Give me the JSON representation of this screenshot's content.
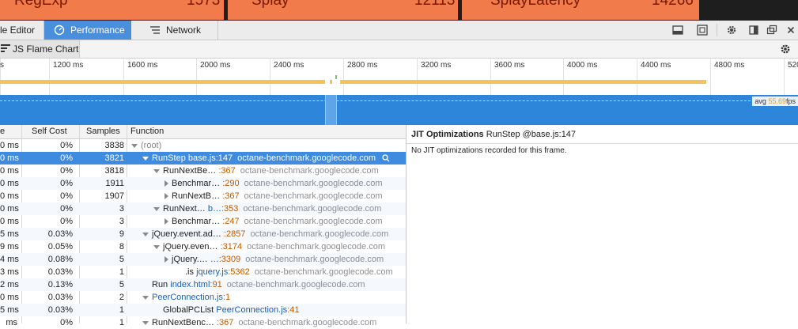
{
  "benchmarks": [
    {
      "name": "RegExp",
      "score": "1573"
    },
    {
      "name": "Splay",
      "score": "12113"
    },
    {
      "name": "SplayLatency",
      "score": "14266"
    }
  ],
  "tabs": {
    "first_partial": "le Editor",
    "performance": "Performance",
    "network": "Network"
  },
  "subtoolbar": {
    "view_label": "JS Flame Chart"
  },
  "timeline": {
    "ticks": [
      "s",
      "1200 ms",
      "1600 ms",
      "2000 ms",
      "2400 ms",
      "2800 ms",
      "3200 ms",
      "3600 ms",
      "4000 ms",
      "4400 ms",
      "4800 ms",
      "520"
    ],
    "fps_label": "avg",
    "fps_value": "55.69",
    "fps_unit": "fps"
  },
  "table": {
    "headers": {
      "total": "e",
      "self": "Self Cost",
      "samples": "Samples",
      "function": "Function"
    },
    "rows": [
      {
        "total": "0 ms",
        "self": "0%",
        "samples": "3838",
        "depth": 0,
        "twisty": "down",
        "name": "(root)",
        "file": "",
        "loc": "",
        "domain": "",
        "root": true
      },
      {
        "total": "0 ms",
        "self": "0%",
        "samples": "3821",
        "depth": 1,
        "twisty": "down",
        "name": "RunStep",
        "file": "base.js",
        "loc": ":147",
        "domain": "octane-benchmark.googlecode.com",
        "selected": true
      },
      {
        "total": "0 ms",
        "self": "0%",
        "samples": "3818",
        "depth": 2,
        "twisty": "down",
        "name": "RunNextBe…",
        "file": "",
        "loc": ":367",
        "domain": "octane-benchmark.googlecode.com"
      },
      {
        "total": "0 ms",
        "self": "0%",
        "samples": "1911",
        "depth": 3,
        "twisty": "right",
        "name": "Benchmar…",
        "file": "",
        "loc": ":290",
        "domain": "octane-benchmark.googlecode.com"
      },
      {
        "total": "0 ms",
        "self": "0%",
        "samples": "1907",
        "depth": 3,
        "twisty": "right",
        "name": "RunNextB…",
        "file": "",
        "loc": ":367",
        "domain": "octane-benchmark.googlecode.com"
      },
      {
        "total": "0 ms",
        "self": "0%",
        "samples": "3",
        "depth": 2,
        "twisty": "down",
        "name": "RunNext…",
        "file": "b…",
        "loc": ":353",
        "domain": "octane-benchmark.googlecode.com"
      },
      {
        "total": "0 ms",
        "self": "0%",
        "samples": "3",
        "depth": 3,
        "twisty": "right",
        "name": "Benchmar…",
        "file": "",
        "loc": ":247",
        "domain": "octane-benchmark.googlecode.com"
      },
      {
        "total": "5 ms",
        "self": "0.03%",
        "samples": "9",
        "depth": 1,
        "twisty": "down",
        "name": "jQuery.event.ad…",
        "file": "",
        "loc": ":2857",
        "domain": "octane-benchmark.googlecode.com"
      },
      {
        "total": "9 ms",
        "self": "0.05%",
        "samples": "8",
        "depth": 2,
        "twisty": "down",
        "name": "jQuery.even…",
        "file": "",
        "loc": ":3174",
        "domain": "octane-benchmark.googlecode.com"
      },
      {
        "total": "4 ms",
        "self": "0.08%",
        "samples": "5",
        "depth": 3,
        "twisty": "right",
        "name": "jQuery.…",
        "file": "…",
        "loc": ":3309",
        "domain": "octane-benchmark.googlecode.com"
      },
      {
        "total": "3 ms",
        "self": "0.03%",
        "samples": "1",
        "depth": 4,
        "twisty": "none",
        "name": ".is",
        "file": "jquery.js",
        "loc": ":5362",
        "domain": "octane-benchmark.googlecode.com"
      },
      {
        "total": "2 ms",
        "self": "0.13%",
        "samples": "5",
        "depth": 1,
        "twisty": "none",
        "name": "Run",
        "file": "index.html",
        "loc": ":91",
        "domain": "octane-benchmark.googlecode.com"
      },
      {
        "total": "0 ms",
        "self": "0.03%",
        "samples": "2",
        "depth": 1,
        "twisty": "down",
        "name": "",
        "file": "PeerConnection.js",
        "loc": ":1",
        "domain": ""
      },
      {
        "total": "5 ms",
        "self": "0.03%",
        "samples": "1",
        "depth": 2,
        "twisty": "none",
        "name": "GlobalPCList",
        "file": "PeerConnection.js",
        "loc": ":41",
        "domain": ""
      },
      {
        "total": "ms",
        "self": "0%",
        "samples": "1",
        "depth": 1,
        "twisty": "down",
        "name": "RunNextBenc…",
        "file": "",
        "loc": ":367",
        "domain": "octane-benchmark.googlecode.com"
      }
    ]
  },
  "jit": {
    "title": "JIT Optimizations",
    "context": "RunStep @base.js:147",
    "message": "No JIT optimizations recorded for this frame."
  },
  "colors": {
    "accent": "#4a8fdc",
    "selected_row": "#3f8be0",
    "fps_band": "#2e86da",
    "bench_tile": "#f17b4b",
    "flame_bar": "#f3c25a"
  }
}
